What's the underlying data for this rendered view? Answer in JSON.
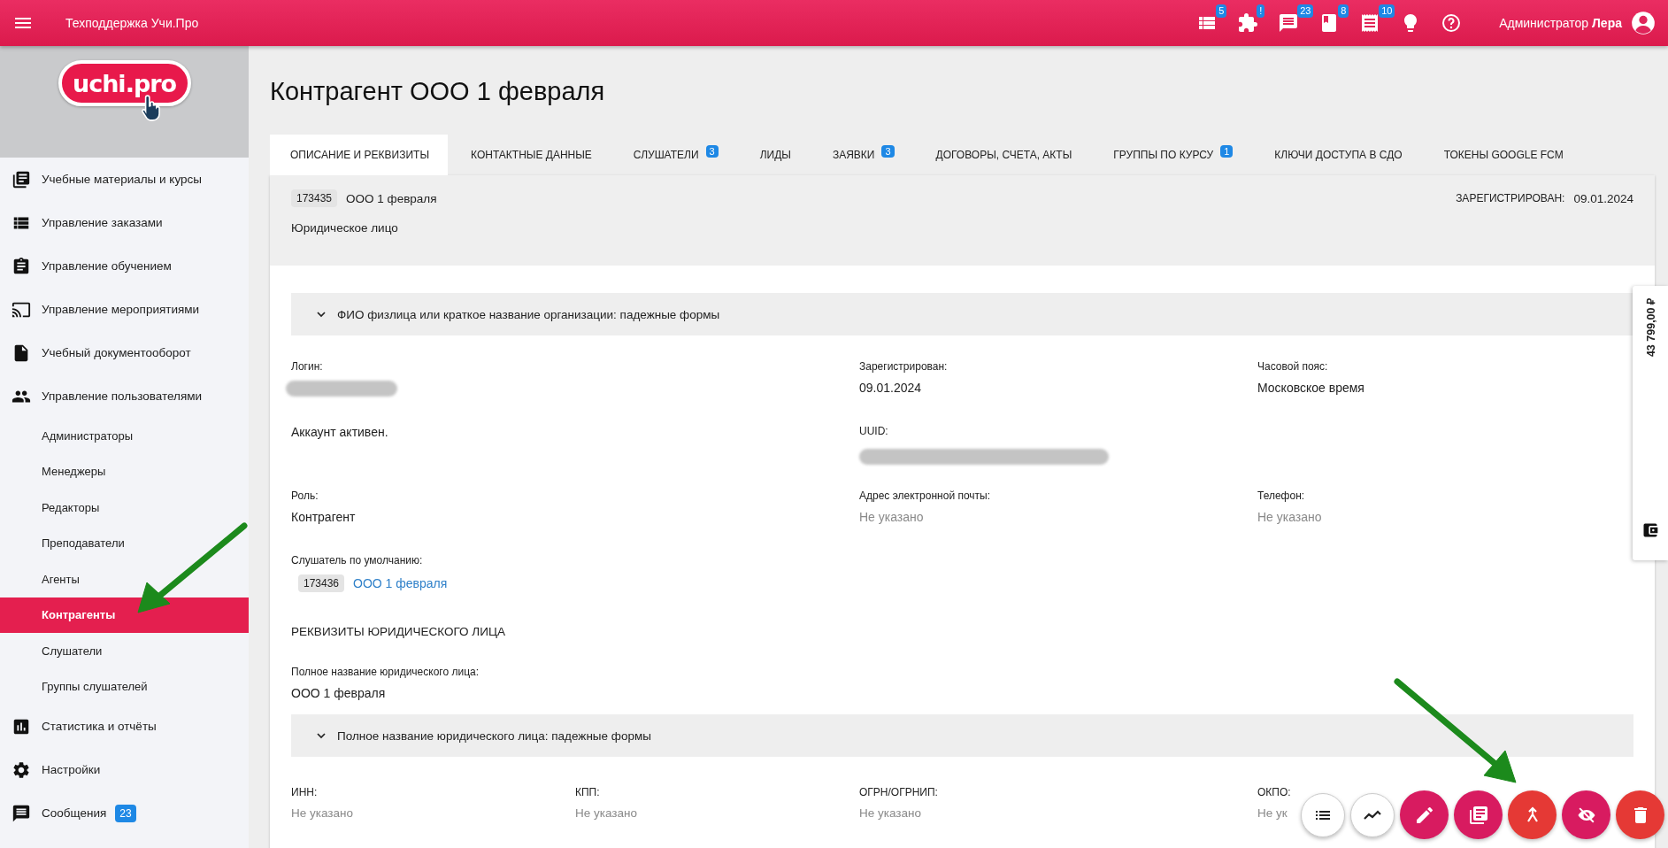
{
  "topbar": {
    "title": "Техподдержка Учи.Про",
    "badges": [
      {
        "badge": "5"
      },
      {
        "badge": "!"
      },
      {
        "badge": "23"
      },
      {
        "badge": "8"
      },
      {
        "badge": "10"
      }
    ],
    "user": "Администратор **Лера**"
  },
  "sidebar": {
    "logo": "uchi.pro",
    "items": [
      {
        "label": "Учебные материалы и курсы"
      },
      {
        "label": "Управление заказами"
      },
      {
        "label": "Управление обучением"
      },
      {
        "label": "Управление мероприятиями"
      },
      {
        "label": "Учебный документооборот"
      },
      {
        "label": "Управление пользователями",
        "children": [
          {
            "label": "Администраторы",
            "selected": false
          },
          {
            "label": "Менеджеры",
            "selected": false
          },
          {
            "label": "Редакторы",
            "selected": false
          },
          {
            "label": "Преподаватели",
            "selected": false
          },
          {
            "label": "Агенты",
            "selected": false
          },
          {
            "label": "Контрагенты",
            "selected": true
          },
          {
            "label": "Слушатели",
            "selected": false
          },
          {
            "label": "Группы слушателей",
            "selected": false
          }
        ]
      },
      {
        "label": "Статистика и отчёты"
      },
      {
        "label": "Настройки"
      },
      {
        "label": "Сообщения",
        "badge": "23"
      }
    ]
  },
  "page_title": "Контрагент ООО 1 февраля",
  "tabs": [
    {
      "label": "ОПИСАНИЕ И РЕКВИЗИТЫ",
      "selected": true
    },
    {
      "label": "КОНТАКТНЫЕ ДАННЫЕ",
      "selected": false
    },
    {
      "label": "СЛУШАТЕЛИ",
      "badge": "3",
      "selected": false
    },
    {
      "label": "ЛИДЫ",
      "selected": false
    },
    {
      "label": "ЗАЯВКИ",
      "badge": "3",
      "selected": false
    },
    {
      "label": "ДОГОВОРЫ, СЧЕТА, АКТЫ",
      "selected": false
    },
    {
      "label": "ГРУППЫ ПО КУРСУ",
      "badge": "1",
      "selected": false
    },
    {
      "label": "КЛЮЧИ ДОСТУПА В СДО",
      "selected": false
    },
    {
      "label": "ТОКЕНЫ GOOGLE FCM",
      "selected": false
    }
  ],
  "header": {
    "id": "173435",
    "name": "ООО 1 февраля",
    "type": "Юридическое лицо",
    "registered_label": "ЗАРЕГИСТРИРОВАН:",
    "registered": "09.01.2024"
  },
  "accordion_1": {
    "title": "ФИО физлица или краткое название организации: падежные формы",
    "expanded": false
  },
  "field_rows": [
    [
      {
        "label": "Логин:",
        "kind": "redacted"
      },
      {
        "label": "Зарегистрирован:",
        "value": "09.01.2024",
        "kind": "plain"
      },
      {
        "label": "Часовой пояс:",
        "value": "Московское время",
        "kind": "plain"
      }
    ],
    [
      {
        "value": "Аккаунт активен.",
        "kind": "plain"
      },
      {
        "label": "UUID:",
        "kind": "redacted"
      }
    ],
    [
      {
        "label": "Роль:",
        "value": "Контрагент",
        "kind": "plain"
      },
      {
        "label": "Адрес электронной почты:",
        "value": "Не указано",
        "kind": "empty"
      },
      {
        "label": "Телефон:",
        "value": "Не указано",
        "kind": "empty"
      }
    ],
    [
      {
        "label": "Слушатель по умолчанию:",
        "id": "173436",
        "value": "ООО 1 февраля",
        "kind": "link"
      }
    ]
  ],
  "section_title": "РЕКВИЗИТЫ ЮРИДИЧЕСКОГО ЛИЦА",
  "legal_name": {
    "label": "Полное название юридического лица:",
    "value": "ООО 1 февраля"
  },
  "accordion_2": {
    "title": "Полное название юридического лица: падежные формы",
    "expanded": false
  },
  "requisites": [
    {
      "label": "ИНН:",
      "value": "Не указано"
    },
    {
      "label": "КПП:",
      "value": "Не указано"
    },
    {
      "label": "ОГРН/ОГРНИП:",
      "value": "Не указано"
    },
    {
      "label": "ОКПО:",
      "value": "Не ук"
    }
  ],
  "side_panel": {
    "amount": "43 799,00 ₽"
  },
  "fab_buttons": [
    {
      "kind": "outline"
    },
    {
      "kind": "outline"
    },
    {
      "kind": "primary"
    },
    {
      "kind": "primary"
    },
    {
      "kind": "danger"
    },
    {
      "kind": "primary"
    },
    {
      "kind": "danger"
    }
  ]
}
